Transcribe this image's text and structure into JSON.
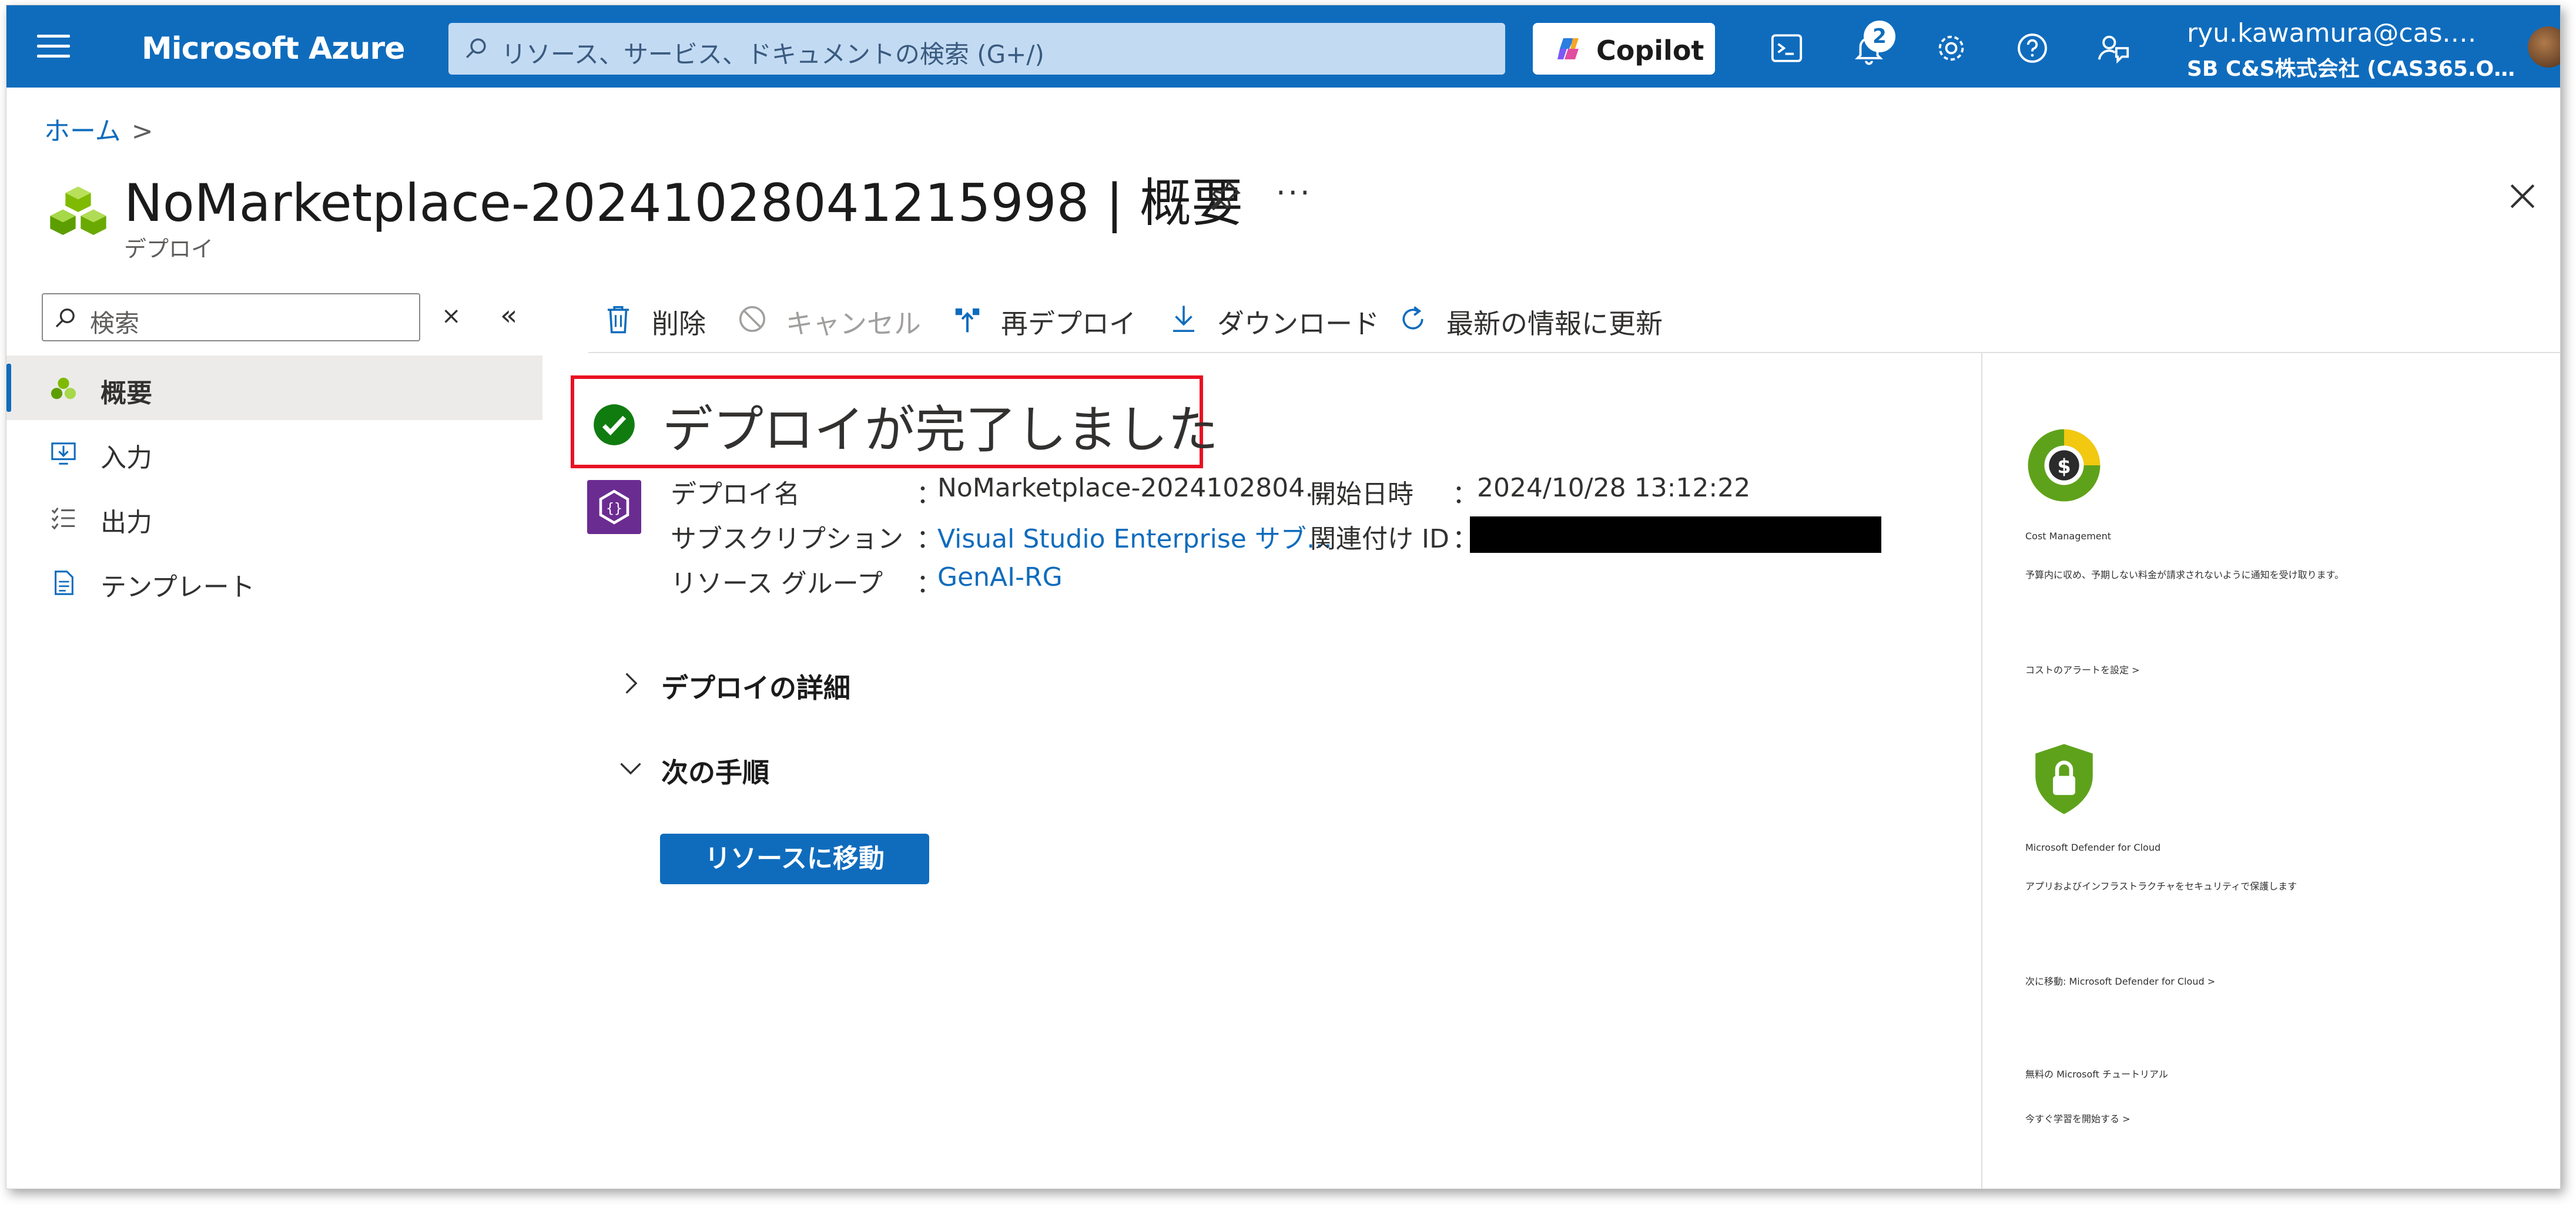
{
  "topbar": {
    "brand": "Microsoft Azure",
    "search_placeholder": "リソース、サービス、ドキュメントの検索 (G+/)",
    "copilot_label": "Copilot",
    "notification_count": "2",
    "user_email": "ryu.kawamura@cas.…",
    "user_org": "SB C&S株式会社 (CAS365.O…",
    "accent": "#0f6cbd"
  },
  "breadcrumb": {
    "home": "ホーム",
    "separator": ">"
  },
  "header": {
    "title": "NoMarketplace-20241028041215998 | 概要",
    "subtitle": "デプロイ",
    "more": "···"
  },
  "nav": {
    "search_placeholder": "検索",
    "clear": "×",
    "collapse": "«",
    "items": [
      {
        "label": "概要",
        "icon": "overview-icon"
      },
      {
        "label": "入力",
        "icon": "input-icon"
      },
      {
        "label": "出力",
        "icon": "output-icon"
      },
      {
        "label": "テンプレート",
        "icon": "template-icon"
      }
    ]
  },
  "toolbar": {
    "delete": "削除",
    "cancel": "キャンセル",
    "redeploy": "再デプロイ",
    "download": "ダウンロード",
    "refresh": "最新の情報に更新"
  },
  "status": {
    "text": "デプロイが完了しました",
    "color": "#107c10"
  },
  "details": {
    "name_label": "デプロイ名",
    "name_value": "NoMarketplace-2024102804…",
    "subscription_label": "サブスクリプション",
    "subscription_value": "Visual Studio Enterprise サブ…",
    "rg_label": "リソース グループ",
    "rg_value": "GenAI-RG",
    "start_label": "開始日時",
    "start_value": "2024/10/28 13:12:22",
    "corr_label": "関連付け ID",
    "colon": "："
  },
  "sections": {
    "deploy_details": "デプロイの詳細",
    "next_steps": "次の手順",
    "go_to_resource": "リソースに移動"
  },
  "right_panel": {
    "cost_title": "Cost Management",
    "cost_desc": "予算内に収め、予期しない料金が請求されないように通知を受け取ります。",
    "cost_link": "コストのアラートを設定 >",
    "defender_title": "Microsoft Defender for Cloud",
    "defender_desc": "アプリおよびインフラストラクチャをセキュリティで保護します",
    "defender_link": "次に移動: Microsoft Defender for Cloud >",
    "tutorial_title": "無料の Microsoft チュートリアル",
    "tutorial_link": "今すぐ学習を開始する >"
  }
}
